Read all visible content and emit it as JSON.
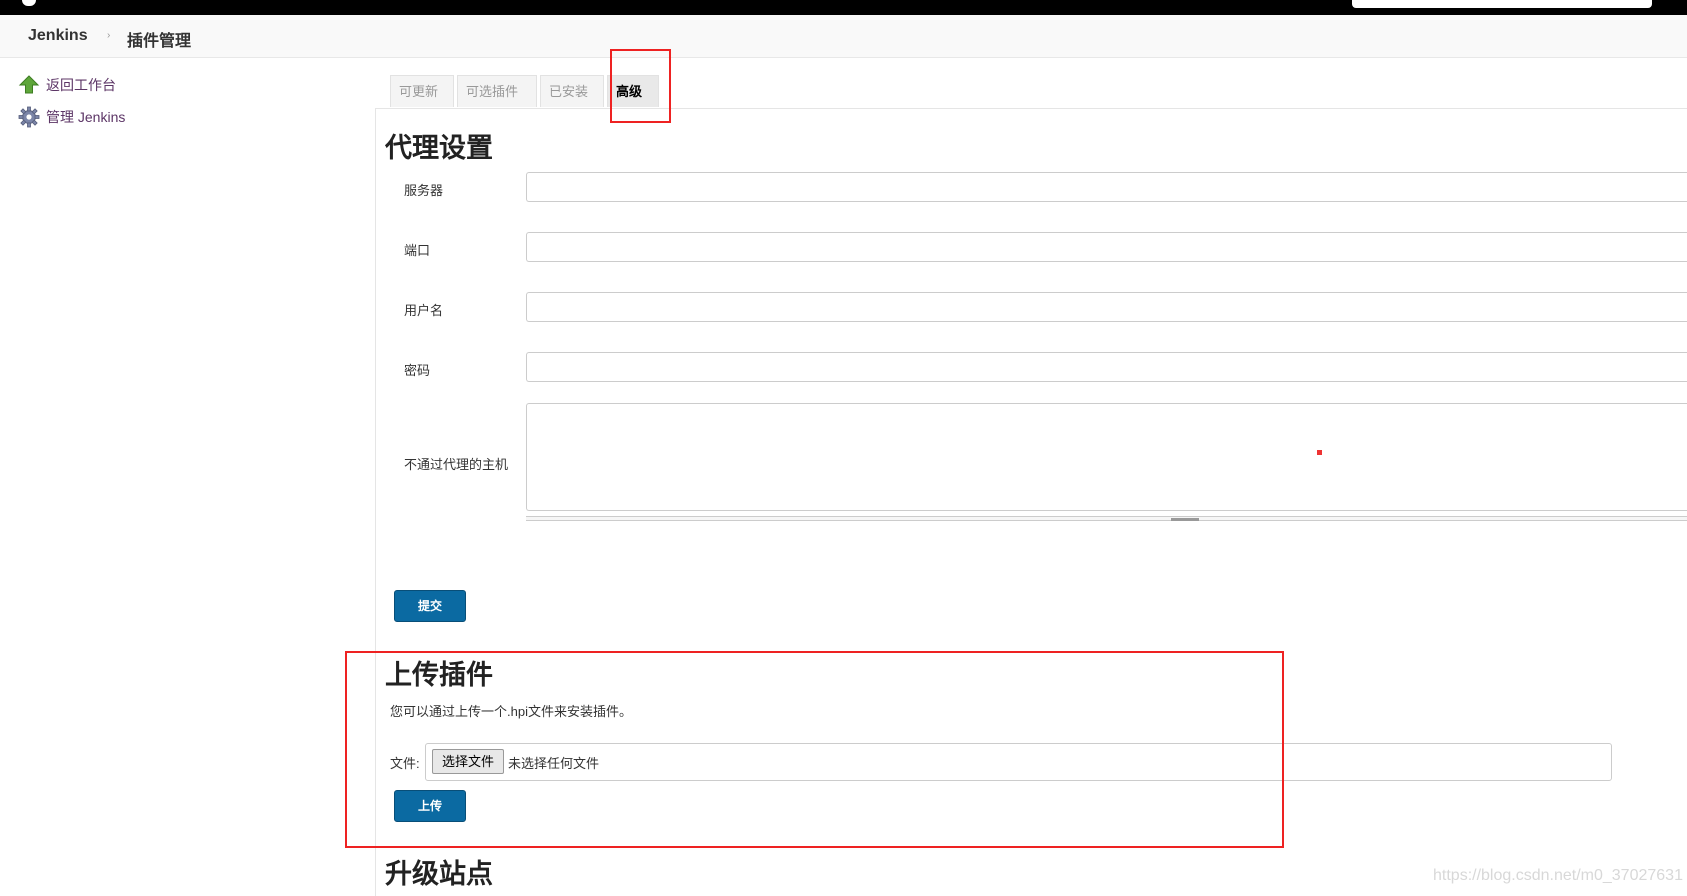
{
  "breadcrumb": {
    "root": "Jenkins",
    "separator": "›",
    "current": "插件管理"
  },
  "sidebar": {
    "items": [
      {
        "label": "返回工作台",
        "icon": "up-arrow-icon"
      },
      {
        "label": "管理 Jenkins",
        "icon": "gear-icon"
      }
    ]
  },
  "tabs": [
    {
      "label": "可更新",
      "active": false
    },
    {
      "label": "可选插件",
      "active": false
    },
    {
      "label": "已安装",
      "active": false
    },
    {
      "label": "高级",
      "active": true
    }
  ],
  "proxy": {
    "title": "代理设置",
    "fields": {
      "server": {
        "label": "服务器",
        "value": ""
      },
      "port": {
        "label": "端口",
        "value": ""
      },
      "username": {
        "label": "用户名",
        "value": ""
      },
      "password": {
        "label": "密码",
        "value": ""
      },
      "no_proxy_hosts": {
        "label": "不通过代理的主机",
        "value": ""
      }
    },
    "submit_label": "提交"
  },
  "upload": {
    "title": "上传插件",
    "description": "您可以通过上传一个.hpi文件来安装插件。",
    "file_label": "文件:",
    "choose_button": "选择文件",
    "file_status": "未选择任何文件",
    "upload_label": "上传"
  },
  "update_site": {
    "title": "升级站点"
  },
  "watermark": "https://blog.csdn.net/m0_37027631",
  "colors": {
    "primary_button": "#0b6aa2",
    "highlight": "#e22222",
    "sidebar_link": "#5c3566"
  }
}
